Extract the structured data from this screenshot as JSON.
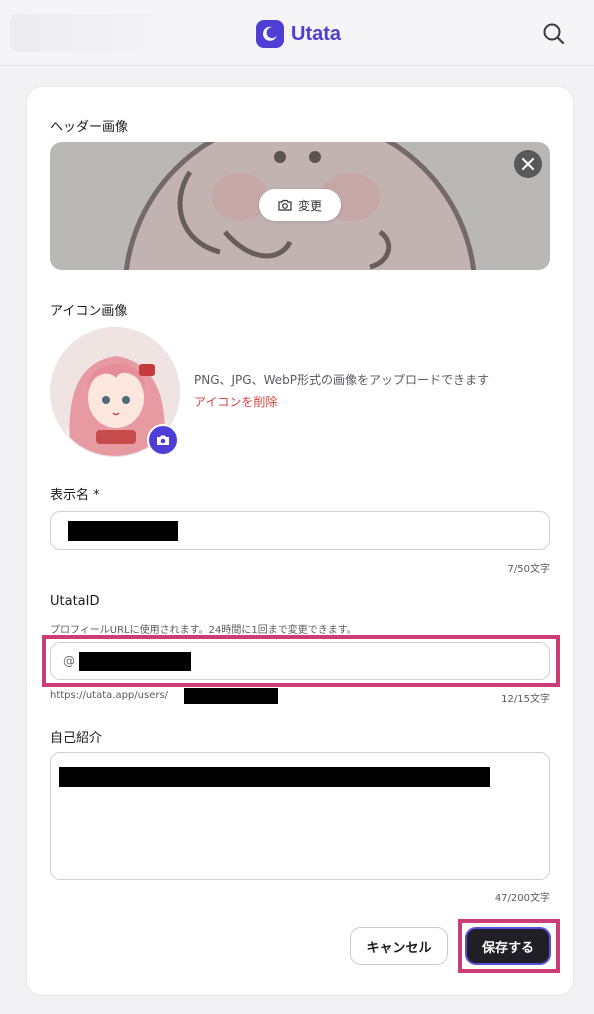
{
  "app": {
    "name": "Utata"
  },
  "icons": {
    "logo": "moon-icon",
    "search": "search-icon",
    "close": "close-icon",
    "camera": "camera-icon"
  },
  "colors": {
    "brand": "#4e3ed6",
    "danger": "#d6453d",
    "highlight": "#cc3d78"
  },
  "header_image": {
    "label": "ヘッダー画像",
    "change_label": "変更"
  },
  "icon_image": {
    "label": "アイコン画像",
    "hint": "PNG、JPG、WebP形式の画像をアップロードできます",
    "delete_label": "アイコンを削除"
  },
  "display_name": {
    "label": "表示名 *",
    "counter": "7/50文字"
  },
  "utata_id": {
    "label": "UtataID",
    "hint": "プロフィールURLに使用されます。24時間に1回まで変更できます。",
    "prefix": "@",
    "url_prefix": "https://utata.app/users/",
    "counter": "12/15文字"
  },
  "bio": {
    "label": "自己紹介",
    "counter": "47/200文字"
  },
  "actions": {
    "cancel_label": "キャンセル",
    "save_label": "保存する"
  }
}
